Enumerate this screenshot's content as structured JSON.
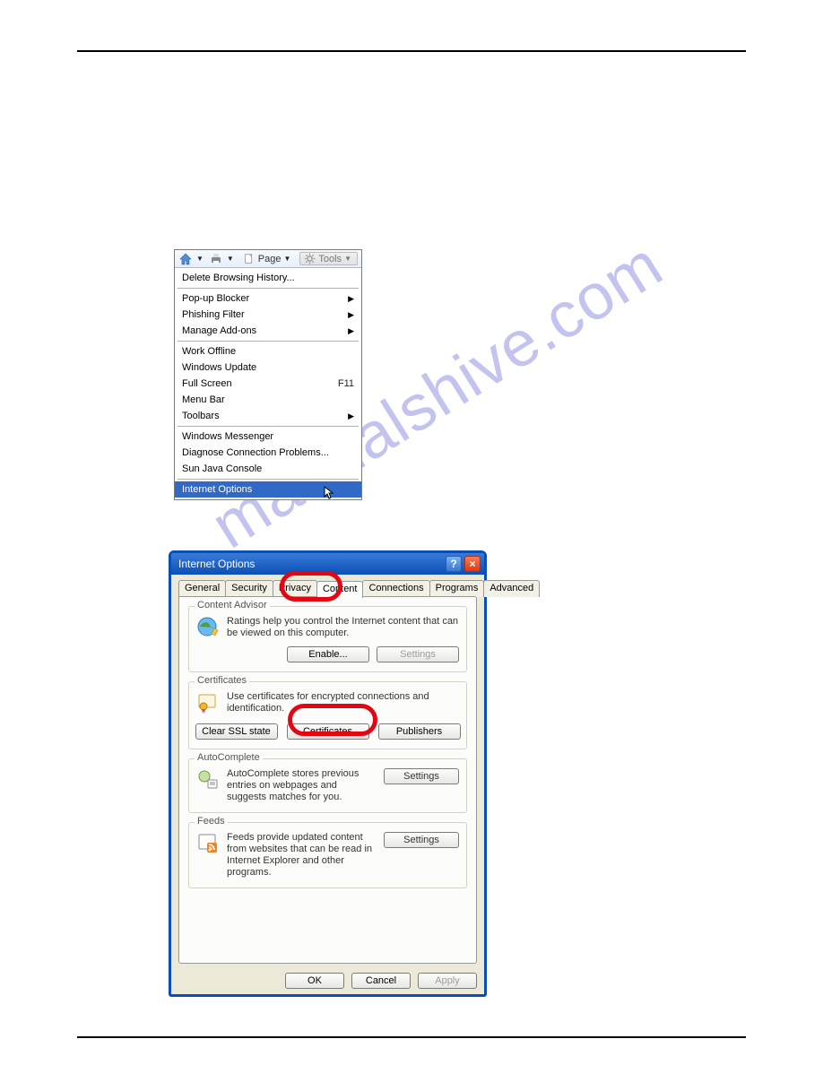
{
  "watermark": "manualshive.com",
  "toolsbar": {
    "page_label": "Page",
    "tools_label": "Tools"
  },
  "menu": {
    "groups": [
      {
        "items": [
          {
            "label": "Delete Browsing History...",
            "submenu": false,
            "shortcut": ""
          }
        ]
      },
      {
        "items": [
          {
            "label": "Pop-up Blocker",
            "submenu": true,
            "shortcut": ""
          },
          {
            "label": "Phishing Filter",
            "submenu": true,
            "shortcut": ""
          },
          {
            "label": "Manage Add-ons",
            "submenu": true,
            "shortcut": ""
          }
        ]
      },
      {
        "items": [
          {
            "label": "Work Offline",
            "submenu": false,
            "shortcut": ""
          },
          {
            "label": "Windows Update",
            "submenu": false,
            "shortcut": ""
          },
          {
            "label": "Full Screen",
            "submenu": false,
            "shortcut": "F11"
          },
          {
            "label": "Menu Bar",
            "submenu": false,
            "shortcut": ""
          },
          {
            "label": "Toolbars",
            "submenu": true,
            "shortcut": ""
          }
        ]
      },
      {
        "items": [
          {
            "label": "Windows Messenger",
            "submenu": false,
            "shortcut": ""
          },
          {
            "label": "Diagnose Connection Problems...",
            "submenu": false,
            "shortcut": ""
          },
          {
            "label": "Sun Java Console",
            "submenu": false,
            "shortcut": ""
          }
        ]
      },
      {
        "items": [
          {
            "label": "Internet Options",
            "submenu": false,
            "shortcut": "",
            "highlight": true
          }
        ]
      }
    ]
  },
  "dialog": {
    "title": "Internet Options",
    "tabs": [
      "General",
      "Security",
      "Privacy",
      "Content",
      "Connections",
      "Programs",
      "Advanced"
    ],
    "active_tab": 3,
    "content_advisor": {
      "title": "Content Advisor",
      "text": "Ratings help you control the Internet content that can be viewed on this computer.",
      "enable_label": "Enable...",
      "settings_label": "Settings"
    },
    "certificates": {
      "title": "Certificates",
      "text": "Use certificates for encrypted connections and identification.",
      "clear_label": "Clear SSL state",
      "certs_label": "Certificates",
      "pub_label": "Publishers"
    },
    "autocomplete": {
      "title": "AutoComplete",
      "text": "AutoComplete stores previous entries on webpages and suggests matches for you.",
      "settings_label": "Settings"
    },
    "feeds": {
      "title": "Feeds",
      "text": "Feeds provide updated content from websites that can be read in Internet Explorer and other programs.",
      "settings_label": "Settings"
    },
    "ok_label": "OK",
    "cancel_label": "Cancel",
    "apply_label": "Apply"
  }
}
